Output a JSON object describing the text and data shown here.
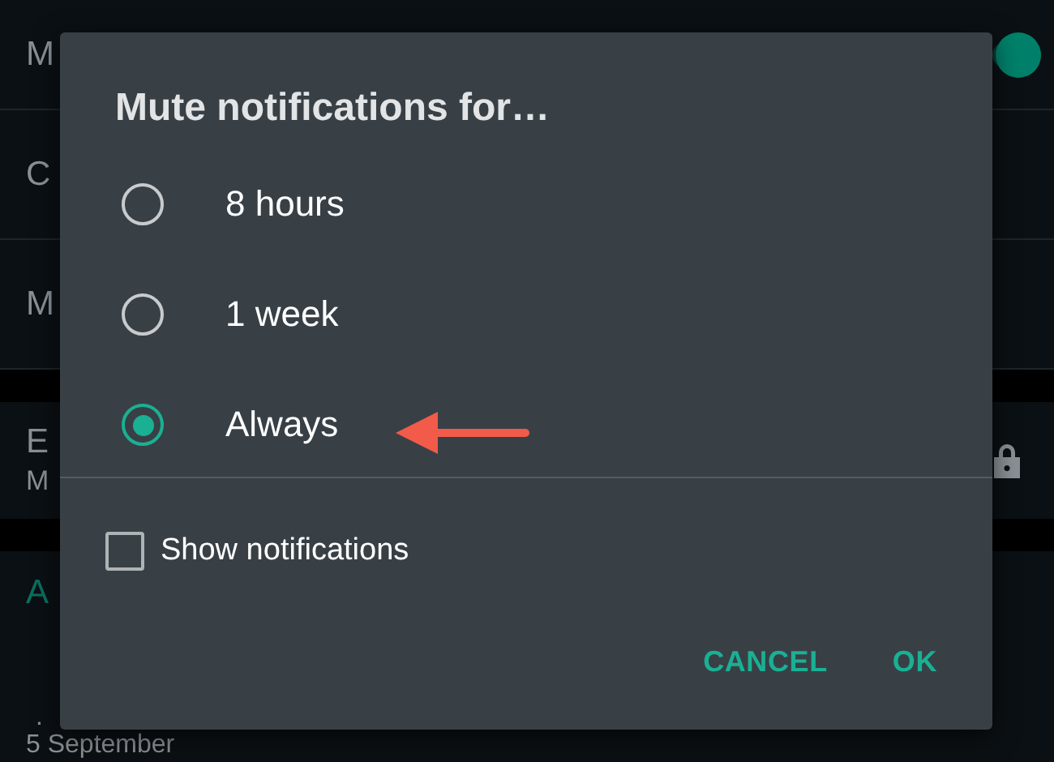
{
  "background": {
    "settings": [
      {
        "title": "M",
        "toggle": {
          "on": true
        }
      },
      {
        "title": "C"
      },
      {
        "title": "M"
      }
    ],
    "encryption": {
      "title": "E",
      "subtitle": "M"
    },
    "section": {
      "heading": "A",
      "items": [
        ".",
        "5 September"
      ]
    }
  },
  "dialog": {
    "title": "Mute notifications for…",
    "options": [
      {
        "label": "8 hours",
        "selected": false
      },
      {
        "label": "1 week",
        "selected": false
      },
      {
        "label": "Always",
        "selected": true
      }
    ],
    "show_notifications": {
      "label": "Show notifications",
      "checked": false
    },
    "buttons": [
      "CANCEL",
      "OK"
    ]
  }
}
